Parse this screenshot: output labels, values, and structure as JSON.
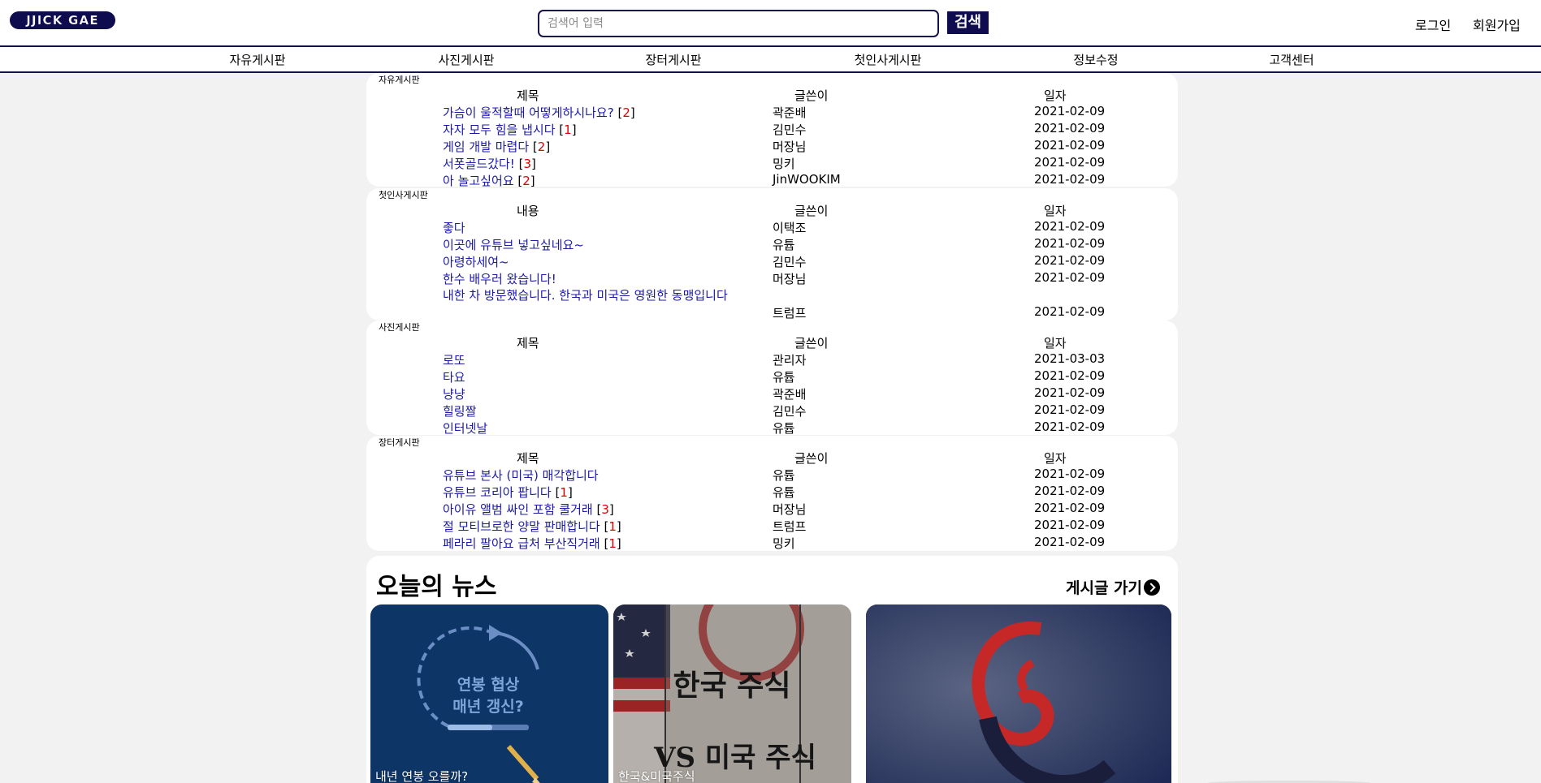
{
  "header": {
    "logo_text": "JJICK GAE",
    "search": {
      "placeholder": "검색어 입력",
      "value": "",
      "button_label": "검색"
    },
    "login_label": "로그인",
    "signup_label": "회원가입"
  },
  "nav": {
    "items": [
      "자유게시판",
      "사진게시판",
      "장터게시판",
      "첫인사게시판",
      "정보수정",
      "고객센터"
    ]
  },
  "boards": {
    "free": {
      "label": "자유게시판",
      "headers": {
        "title": "제목",
        "author": "글쓴이",
        "date": "일자"
      },
      "rows": [
        {
          "title": "가슴이 울적할때 어떻게하시나요?",
          "comments": "2",
          "author": "곽준배",
          "date": "2021-02-09"
        },
        {
          "title": "자자 모두 힘을 냅시다",
          "comments": "1",
          "author": "김민수",
          "date": "2021-02-09"
        },
        {
          "title": "게임 개발 마렵다",
          "comments": "2",
          "author": "머장님",
          "date": "2021-02-09"
        },
        {
          "title": "서폿골드갔다!",
          "comments": "3",
          "author": "밍키",
          "date": "2021-02-09"
        },
        {
          "title": "아 놀고싶어요",
          "comments": "2",
          "author": "JinWOOKIM",
          "date": "2021-02-09"
        }
      ]
    },
    "greeting": {
      "label": "첫인사게시판",
      "headers": {
        "title": "내용",
        "author": "글쓴이",
        "date": "일자"
      },
      "rows": [
        {
          "title": "좋다",
          "author": "이택조",
          "date": "2021-02-09"
        },
        {
          "title": "이곳에 유튜브 넣고싶네요~",
          "author": "유튭",
          "date": "2021-02-09"
        },
        {
          "title": "아령하세여~",
          "author": "김민수",
          "date": "2021-02-09"
        },
        {
          "title": "한수 배우러 왔습니다!",
          "author": "머장님",
          "date": "2021-02-09"
        },
        {
          "title": "내한 차 방문했습니다. 한국과 미국은 영원한 동맹입니다",
          "author": "트럼프",
          "date": "2021-02-09"
        }
      ]
    },
    "photo": {
      "label": "사진게시판",
      "headers": {
        "title": "제목",
        "author": "글쓴이",
        "date": "일자"
      },
      "rows": [
        {
          "title": "로또",
          "author": "관리자",
          "date": "2021-03-03"
        },
        {
          "title": "타요",
          "author": "유튭",
          "date": "2021-02-09"
        },
        {
          "title": "냥냥",
          "author": "곽준배",
          "date": "2021-02-09"
        },
        {
          "title": "힐링짤",
          "author": "김민수",
          "date": "2021-02-09"
        },
        {
          "title": "인터넷날",
          "author": "유튭",
          "date": "2021-02-09"
        }
      ]
    },
    "market": {
      "label": "장터게시판",
      "headers": {
        "title": "제목",
        "author": "글쓴이",
        "date": "일자"
      },
      "rows": [
        {
          "title": "유튜브 본사 (미국) 매각합니다",
          "author": "유튭",
          "date": "2021-02-09"
        },
        {
          "title": "유튜브 코리아 팝니다",
          "comments": "1",
          "author": "유튭",
          "date": "2021-02-09"
        },
        {
          "title": "아이유 앨범 싸인 포함 쿨거래",
          "comments": "3",
          "author": "머장님",
          "date": "2021-02-09"
        },
        {
          "title": "절 모티브로한 양말 판매합니다",
          "comments": "1",
          "author": "트럼프",
          "date": "2021-02-09"
        },
        {
          "title": "페라리 팔아요 급처 부산직거래",
          "comments": "1",
          "author": "밍키",
          "date": "2021-02-09"
        }
      ]
    }
  },
  "news": {
    "title": "오늘의 뉴스",
    "more_label": "게시글 가기",
    "cards": [
      {
        "caption": "내년 연봉 오를까?",
        "image_text": [
          "연봉 협상",
          "매년 갱신?"
        ]
      },
      {
        "caption": "한국&미국주식",
        "image_text": [
          "한국 주식",
          "VS 미국 주식"
        ]
      },
      {
        "caption": ""
      }
    ]
  },
  "colors": {
    "brand_navy": "#0e0b4f",
    "link_blue": "#1c1ba8",
    "comment_red": "#e00000",
    "page_bg": "#f2f2f2"
  }
}
